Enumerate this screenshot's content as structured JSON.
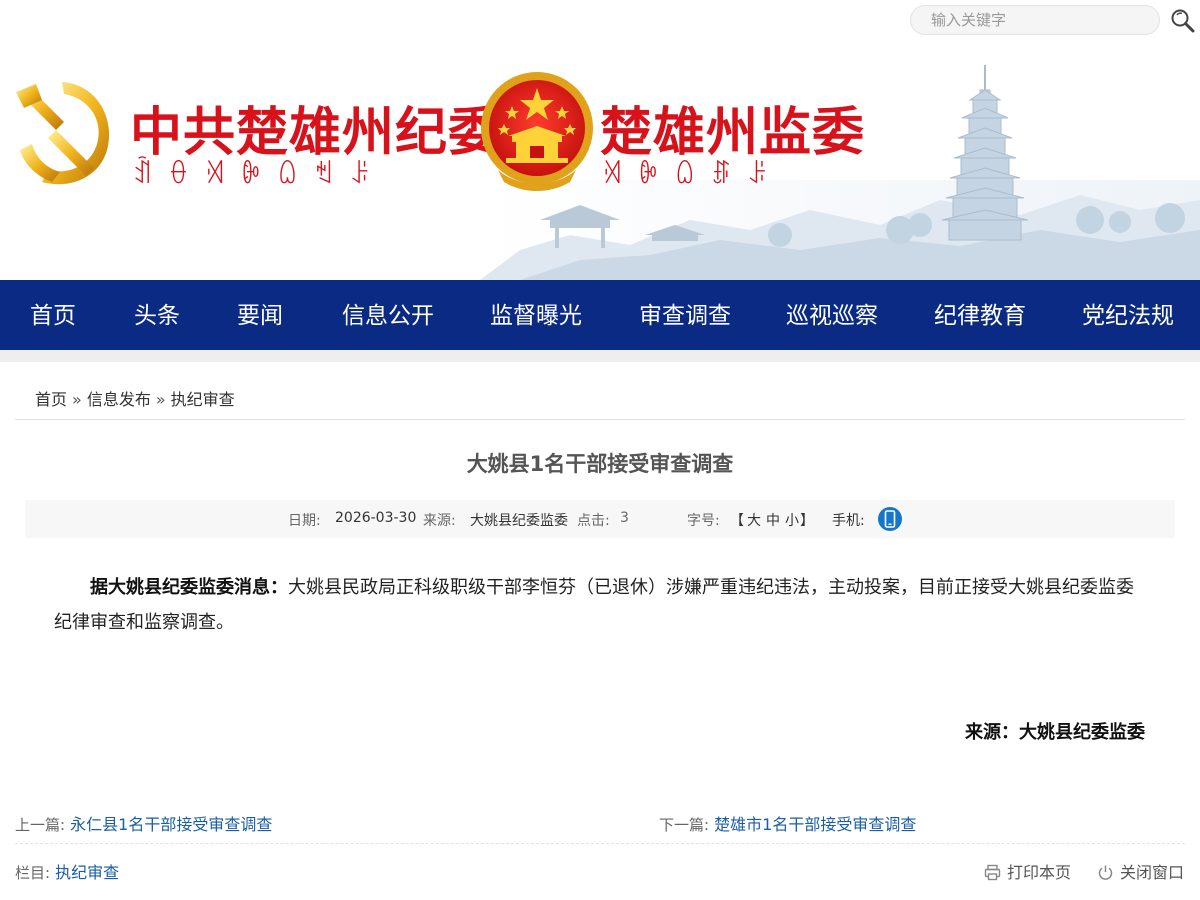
{
  "search": {
    "placeholder": "输入关键字",
    "icon": "search-icon"
  },
  "banner": {
    "left_title": "中共楚雄州纪委",
    "left_subtitle": "ꀉꂷꄉꐊꑘꈐꌠ",
    "right_title": "楚雄州监委",
    "right_subtitle": "ꄉꐊꑘꁓꌠ",
    "brand_color": "#d8121b"
  },
  "nav": {
    "background": "#0b2a83",
    "items": [
      "首页",
      "头条",
      "要闻",
      "信息公开",
      "监督曝光",
      "审查调查",
      "巡视巡察",
      "纪律教育",
      "党纪法规"
    ]
  },
  "breadcrumb": {
    "home": "首页",
    "sep": "»",
    "level1": "信息发布",
    "level2": "执纪审查"
  },
  "article": {
    "title": "大姚县1名干部接受审查调查",
    "meta": {
      "date_label": "日期:",
      "date": "2026-03-30",
      "source_label": "来源:",
      "source": "大姚县纪委监委",
      "clicks_label": "点击:",
      "clicks": "3",
      "fontsize_label": "字号:",
      "size_open": "【",
      "size_large": "大",
      "size_medium": "中",
      "size_small": "小",
      "size_close": "】",
      "mobile_label": "手机:",
      "mobile_icon": "mobile-phone-icon"
    },
    "lead": "据大姚县纪委监委消息：",
    "body": "大姚县民政局正科级职级干部李恒芬（已退休）涉嫌严重违纪违法，主动投案，目前正接受大姚县纪委监委纪律审查和监察调查。",
    "source_line": "来源：大姚县纪委监委"
  },
  "pagination": {
    "prev_label": "上一篇:",
    "prev_title": "永仁县1名干部接受审查调查",
    "next_label": "下一篇:",
    "next_title": "楚雄市1名干部接受审查调查"
  },
  "footer": {
    "column_label": "栏目:",
    "column_value": "执纪审查",
    "print_label": "打印本页",
    "close_label": "关闭窗口",
    "print_icon": "printer-icon",
    "close_icon": "power-icon"
  },
  "colors": {
    "link": "#1a5ea8",
    "nav": "#0b2a83",
    "accent": "#d8121b"
  }
}
